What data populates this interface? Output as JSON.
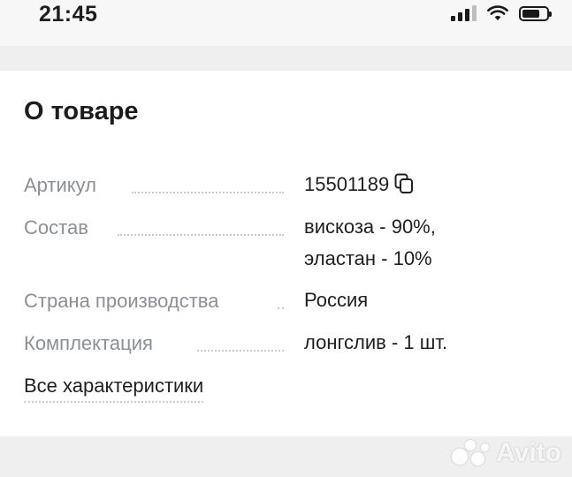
{
  "status_bar": {
    "time": "21:45",
    "icons": [
      "cellular-signal-icon",
      "wifi-icon",
      "battery-icon"
    ]
  },
  "section": {
    "title": "О товаре",
    "rows": [
      {
        "label": "Артикул",
        "value": "15501189",
        "icon": "copy-icon"
      },
      {
        "label": "Состав",
        "value": "вискоза - 90%,",
        "value2": "эластан - 10%"
      },
      {
        "label": "Страна производства",
        "value": "Россия"
      },
      {
        "label": "Комплектация",
        "value": "лонгслив - 1 шт."
      }
    ],
    "all_link": "Все характеристики"
  },
  "watermark": {
    "text": "Avito"
  },
  "colors": {
    "label": "#8b8f96",
    "text": "#1f1f1f",
    "background": "#efefef",
    "card": "#ffffff"
  }
}
